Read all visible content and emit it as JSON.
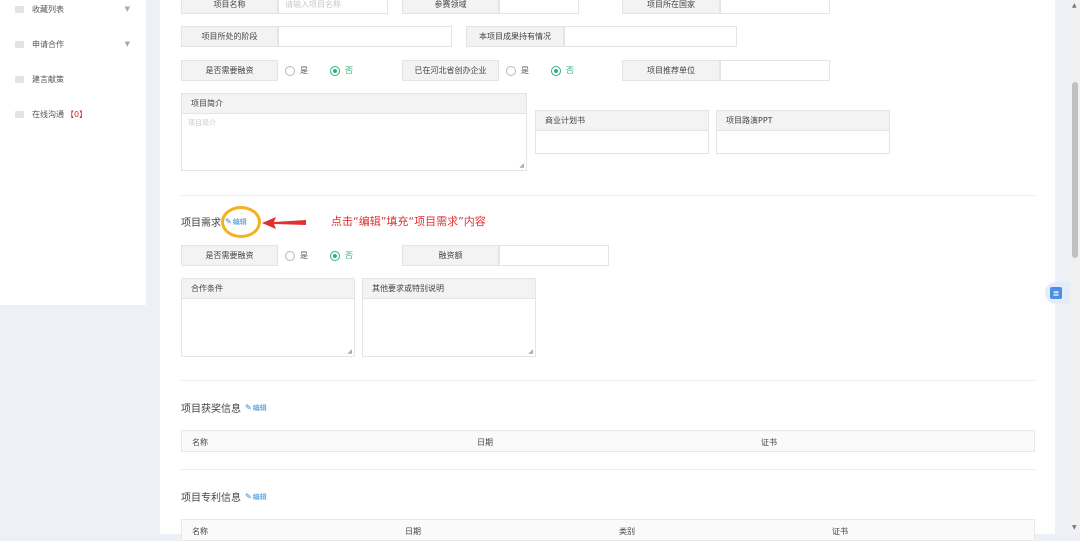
{
  "sidebar": {
    "items": [
      {
        "label": "收藏列表",
        "has_arrow": true
      },
      {
        "label": "申请合作",
        "has_arrow": true
      },
      {
        "label": "建言献策",
        "has_arrow": false
      },
      {
        "label": "在线沟通",
        "badge": "【0】",
        "has_arrow": false
      }
    ]
  },
  "form": {
    "row1": {
      "project_name_label": "项目名称",
      "project_name_placeholder": "请输入项目名称",
      "field_label": "参赛领域",
      "country_label": "项目所在国家"
    },
    "row2": {
      "stage_label": "项目所处的阶段",
      "ownership_label": "本项目成果持有情况"
    },
    "row3": {
      "financing_label": "是否需要融资",
      "yes": "是",
      "no": "否",
      "hebei_label": "已在河北省创办企业",
      "recommender_label": "项目推荐单位"
    },
    "intro": {
      "label": "项目简介",
      "placeholder": "项目简介"
    },
    "business_plan_label": "商业计划书",
    "roadshow_label": "项目路演PPT"
  },
  "needs": {
    "title": "项目需求",
    "edit": "编辑",
    "financing_label": "是否需要融资",
    "yes": "是",
    "no": "否",
    "amount_label": "融资额",
    "coop_label": "合作条件",
    "other_label": "其他要求或特别说明"
  },
  "annotation": {
    "text": "点击“编辑”填充“项目需求”内容"
  },
  "awards": {
    "title": "项目获奖信息",
    "edit": "编辑",
    "columns": [
      "名称",
      "日期",
      "证书"
    ]
  },
  "patents": {
    "title": "项目专利信息",
    "edit": "编辑",
    "columns": [
      "名称",
      "日期",
      "类别",
      "证书"
    ]
  },
  "colors": {
    "accent_green": "#2db37a",
    "link_blue": "#2a8bd8",
    "annotation_red": "#e03030",
    "highlight_circle": "#f5b01b"
  }
}
